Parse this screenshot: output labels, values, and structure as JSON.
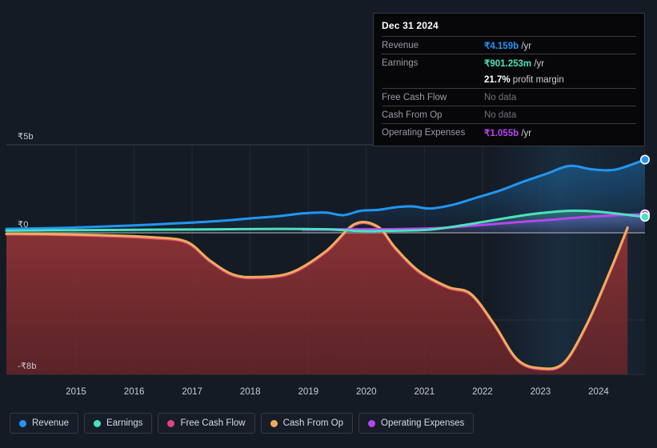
{
  "chart_data": {
    "type": "line",
    "title": "",
    "xlabel": "",
    "ylabel": "",
    "currency_symbol": "₹",
    "x_tick_labels": [
      "2015",
      "2016",
      "2017",
      "2018",
      "2019",
      "2020",
      "2021",
      "2022",
      "2023",
      "2024"
    ],
    "y_tick_labels": [
      "₹5b",
      "₹0",
      "-₹8b"
    ],
    "ylim": [
      -8,
      5
    ],
    "xlim": [
      2014.3,
      2025.3
    ],
    "grid": true,
    "legend_position": "bottom",
    "series": [
      {
        "name": "Revenue",
        "color": "#2196f3",
        "x": [
          2014.3,
          2015,
          2015.5,
          2016,
          2016.5,
          2017,
          2017.5,
          2018,
          2018.5,
          2019,
          2019.4,
          2019.8,
          2020.1,
          2020.4,
          2020.7,
          2021,
          2021.3,
          2021.6,
          2022,
          2022.4,
          2022.8,
          2023.2,
          2023.6,
          2024,
          2024.4,
          2024.8,
          2025.3
        ],
        "values": [
          0.22,
          0.26,
          0.3,
          0.36,
          0.42,
          0.5,
          0.58,
          0.68,
          0.82,
          0.95,
          1.1,
          1.15,
          1.0,
          1.25,
          1.3,
          1.45,
          1.5,
          1.38,
          1.6,
          2.0,
          2.4,
          2.9,
          3.35,
          3.8,
          3.6,
          3.6,
          4.159
        ]
      },
      {
        "name": "Earnings",
        "color": "#4ce1c0",
        "x": [
          2014.3,
          2015,
          2016,
          2017,
          2018,
          2019,
          2019.8,
          2020.4,
          2021,
          2021.6,
          2022.2,
          2022.8,
          2023.4,
          2024,
          2024.5,
          2025.3
        ],
        "values": [
          0.12,
          0.14,
          0.16,
          0.18,
          0.2,
          0.22,
          0.2,
          0.1,
          0.12,
          0.18,
          0.45,
          0.78,
          1.08,
          1.25,
          1.2,
          0.901
        ]
      },
      {
        "name": "Free Cash Flow",
        "color": "#e0437f",
        "x": [
          2014.3,
          2015,
          2016,
          2016.8,
          2017.4,
          2017.8,
          2018.2,
          2018.6,
          2019.2,
          2019.8,
          2020.3,
          2020.7,
          2021,
          2021.4,
          2021.9,
          2022.3,
          2022.7,
          2023.1,
          2023.5,
          2023.9,
          2024.3,
          2024.7,
          2025.0
        ],
        "values": [
          -0.08,
          -0.1,
          -0.18,
          -0.3,
          -0.55,
          -1.6,
          -2.4,
          -2.55,
          -2.3,
          -1.1,
          0.45,
          0.3,
          -0.9,
          -2.2,
          -3.1,
          -3.5,
          -5.2,
          -7.2,
          -7.7,
          -7.4,
          -5.2,
          -2.2,
          0.25
        ]
      },
      {
        "name": "Cash From Op",
        "color": "#eead58",
        "x": [
          2014.3,
          2015,
          2016,
          2016.8,
          2017.4,
          2017.8,
          2018.2,
          2018.6,
          2019.2,
          2019.8,
          2020.3,
          2020.7,
          2021,
          2021.4,
          2021.9,
          2022.3,
          2022.7,
          2023.1,
          2023.5,
          2023.9,
          2024.3,
          2024.7,
          2025.0
        ],
        "values": [
          -0.05,
          -0.07,
          -0.14,
          -0.25,
          -0.5,
          -1.55,
          -2.35,
          -2.5,
          -2.25,
          -1.05,
          0.5,
          0.35,
          -0.85,
          -2.15,
          -3.05,
          -3.45,
          -5.15,
          -7.15,
          -7.65,
          -7.35,
          -5.15,
          -2.15,
          0.3
        ]
      },
      {
        "name": "Operating Expenses",
        "color": "#b646f0",
        "x": [
          2019.4,
          2020,
          2020.6,
          2021.2,
          2021.8,
          2022.4,
          2023,
          2023.6,
          2024.2,
          2024.8,
          2025.3
        ],
        "values": [
          0.18,
          0.2,
          0.2,
          0.22,
          0.28,
          0.42,
          0.58,
          0.72,
          0.88,
          1.0,
          1.055
        ]
      }
    ],
    "endpoints": [
      {
        "name": "Revenue",
        "x": 2025.3,
        "value": 4.159,
        "color": "#2196f3"
      },
      {
        "name": "Operating Expenses",
        "x": 2025.3,
        "value": 1.055,
        "color": "#b646f0"
      },
      {
        "name": "Earnings",
        "x": 2025.3,
        "value": 0.901,
        "color": "#4ce1c0"
      }
    ]
  },
  "tooltip": {
    "title": "Dec 31 2024",
    "rows": [
      {
        "key": "Revenue",
        "value": "₹4.159b",
        "unit": "/yr",
        "color": "#2196f3",
        "no_data": false
      },
      {
        "key": "Earnings",
        "value": "₹901.253m",
        "unit": "/yr",
        "color": "#4ce1c0",
        "no_data": false
      },
      {
        "key": "",
        "value": "21.7%",
        "unit": "profit margin",
        "color": "#ffffff",
        "no_data": false
      },
      {
        "key": "Free Cash Flow",
        "value": "No data",
        "unit": "",
        "color": "#70707a",
        "no_data": true
      },
      {
        "key": "Cash From Op",
        "value": "No data",
        "unit": "",
        "color": "#70707a",
        "no_data": true
      },
      {
        "key": "Operating Expenses",
        "value": "₹1.055b",
        "unit": "/yr",
        "color": "#b646f0",
        "no_data": false
      }
    ]
  },
  "legend": {
    "items": [
      {
        "label": "Revenue",
        "color": "#2196f3"
      },
      {
        "label": "Earnings",
        "color": "#4ce1c0"
      },
      {
        "label": "Free Cash Flow",
        "color": "#e0437f"
      },
      {
        "label": "Cash From Op",
        "color": "#eead58"
      },
      {
        "label": "Operating Expenses",
        "color": "#b646f0"
      }
    ]
  },
  "colors": {
    "background": "#151b25",
    "negative_fill": "#7a2f32",
    "gridline": "#2c323d",
    "zero_line": "#9aa0a8"
  }
}
